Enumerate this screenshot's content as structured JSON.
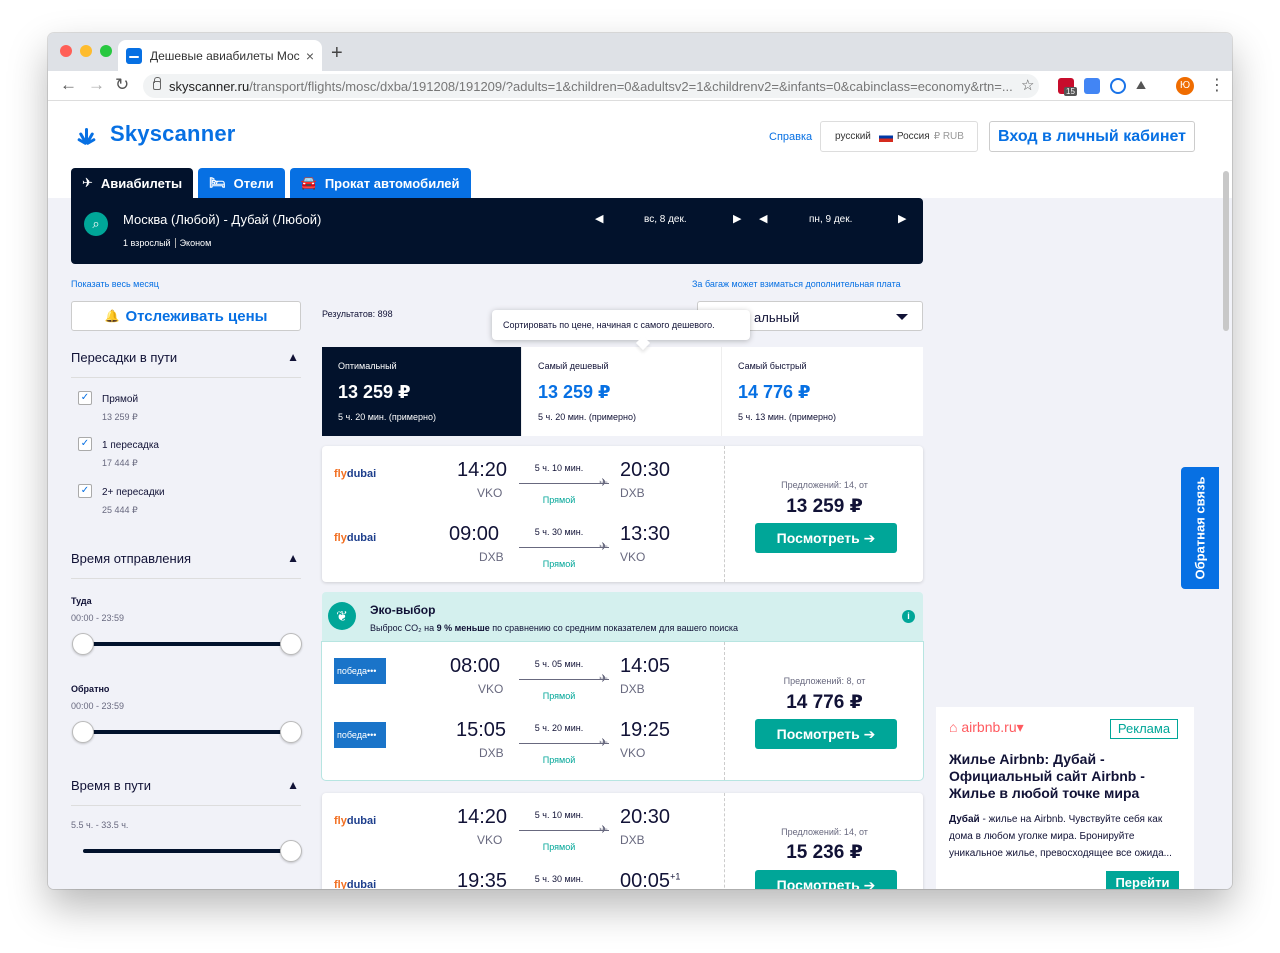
{
  "browser": {
    "tab_title": "Дешевые авиабилеты Москва",
    "url_host": "skyscanner.ru",
    "url_path": "/transport/flights/mosc/dxba/191208/191209/?adults=1&children=0&adultsv2=1&childrenv2=&infants=0&cabinclass=economy&rtn=...",
    "ext_badge": "15",
    "avatar_letter": "Ю"
  },
  "header": {
    "logo": "Skyscanner",
    "help": "Справка",
    "language": "русский",
    "country": "Россия",
    "currency": "₽ RUB",
    "login": "Вход в личный кабинет"
  },
  "service_tabs": [
    {
      "label": "Авиабилеты",
      "icon": "plane-icon"
    },
    {
      "label": "Отели",
      "icon": "bed-icon"
    },
    {
      "label": "Прокат автомобилей",
      "icon": "car-icon"
    }
  ],
  "search": {
    "route": "Москва (Любой) - Дубай (Любой)",
    "passengers": "1 взрослый",
    "cabin": "Эконом",
    "depart_date": "вс, 8 дек.",
    "return_date": "пн, 9 дек."
  },
  "links": {
    "show_month": "Показать весь месяц",
    "baggage": "За багаж может взиматься дополнительная плата"
  },
  "sidebar": {
    "track_prices": "Отслеживать цены",
    "stops_title": "Пересадки в пути",
    "stops": [
      {
        "label": "Прямой",
        "price": "13 259 ₽",
        "checked": true
      },
      {
        "label": "1 пересадка",
        "price": "17 444 ₽",
        "checked": true
      },
      {
        "label": "2+ пересадки",
        "price": "25 444 ₽",
        "checked": true
      }
    ],
    "departure_title": "Время отправления",
    "outbound_label": "Туда",
    "outbound_range": "00:00 - 23:59",
    "return_label": "Обратно",
    "return_range": "00:00 - 23:59",
    "duration_title": "Время в пути",
    "duration_range": "5.5 ч. - 33.5 ч."
  },
  "results": {
    "count": "Результатов: 898",
    "sort_value": "альный",
    "tooltip": "Сортировать по цене, начиная с самого дешевого."
  },
  "sort_tabs": [
    {
      "title": "Оптимальный",
      "price": "13 259 ₽",
      "duration": "5 ч. 20 мин. (примерно)"
    },
    {
      "title": "Самый дешевый",
      "price": "13 259 ₽",
      "duration": "5 ч. 20 мин. (примерно)"
    },
    {
      "title": "Самый быстрый",
      "price": "14 776 ₽",
      "duration": "5 ч. 13 мин. (примерно)"
    }
  ],
  "eco": {
    "title": "Эко-выбор",
    "desc_prefix": "Выброс CO₂ на ",
    "desc_bold": "9 % меньше",
    "desc_suffix": " по сравнению со средним показателем для вашего поиска"
  },
  "cards": [
    {
      "airline": "flydubai",
      "legs": [
        {
          "dep": "14:20",
          "from": "VKO",
          "dur": "5 ч. 10 мин.",
          "stops": "Прямой",
          "arr": "20:30",
          "to": "DXB"
        },
        {
          "dep": "09:00",
          "from": "DXB",
          "dur": "5 ч. 30 мин.",
          "stops": "Прямой",
          "arr": "13:30",
          "to": "VKO"
        }
      ],
      "offers": "Предложений: 14, от",
      "price": "13 259 ₽",
      "button": "Посмотреть ➔"
    },
    {
      "airline": "победа",
      "legs": [
        {
          "dep": "08:00",
          "from": "VKO",
          "dur": "5 ч. 05 мин.",
          "stops": "Прямой",
          "arr": "14:05",
          "to": "DXB"
        },
        {
          "dep": "15:05",
          "from": "DXB",
          "dur": "5 ч. 20 мин.",
          "stops": "Прямой",
          "arr": "19:25",
          "to": "VKO"
        }
      ],
      "offers": "Предложений: 8, от",
      "price": "14 776 ₽",
      "button": "Посмотреть ➔"
    },
    {
      "airline": "flydubai",
      "legs": [
        {
          "dep": "14:20",
          "from": "VKO",
          "dur": "5 ч. 10 мин.",
          "stops": "Прямой",
          "arr": "20:30",
          "to": "DXB"
        },
        {
          "dep": "19:35",
          "from": "",
          "dur": "5 ч. 30 мин.",
          "stops": "",
          "arr": "00:05",
          "to": "",
          "plus": "+1"
        }
      ],
      "offers": "Предложений: 14, от",
      "price": "15 236 ₽",
      "button": "Посмотреть ➔"
    }
  ],
  "feedback": "Обратная связь",
  "ad": {
    "brand": "airbnb.ru",
    "tag": "Реклама",
    "title": "Жилье Airbnb: Дубай - Официальный сайт Airbnb - Жилье в любой точке мира",
    "text_bold": "Дубай",
    "text": " - жилье на Airbnb. Чувствуйте себя как дома в любом уголке мира. Бронируйте уникальное жилье, превосходящее все ожида...",
    "button": "Перейти"
  }
}
